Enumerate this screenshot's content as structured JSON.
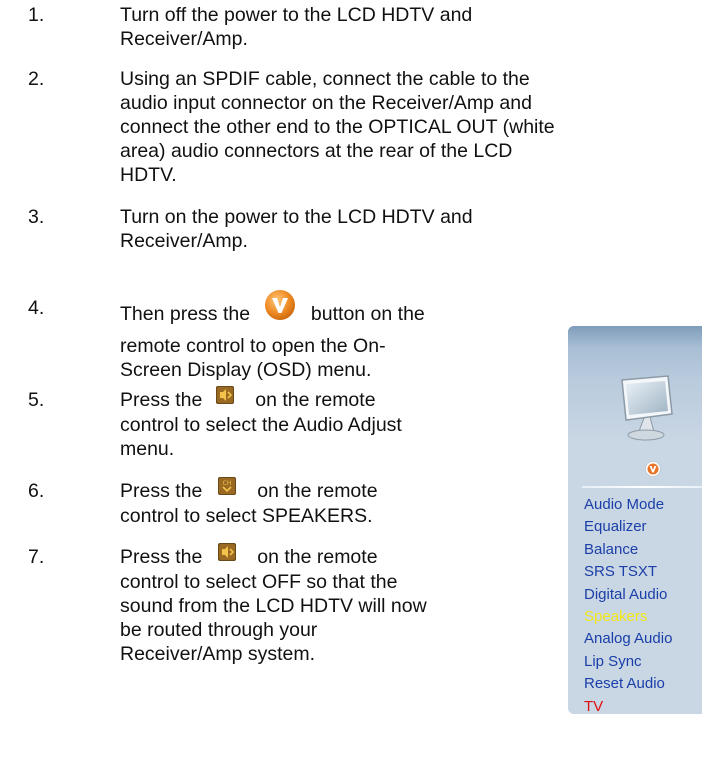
{
  "steps": [
    {
      "num": "1.",
      "lines": [
        "Turn off the power to the LCD HDTV and",
        "Receiver/Amp."
      ]
    },
    {
      "num": "2.",
      "lines": [
        "Using an SPDIF cable, connect the cable to the",
        "audio input connector on the Receiver/Amp and",
        "connect the other end to the OPTICAL OUT (white",
        "area) audio connectors at the rear of the LCD",
        "HDTV."
      ]
    },
    {
      "num": "3.",
      "lines": [
        "Turn on the power to the LCD HDTV and",
        "Receiver/Amp."
      ]
    },
    {
      "num": "4.",
      "pre": "Then press the",
      "post": "button on the",
      "lines": [
        "remote control to open the On-",
        "Screen Display (OSD) menu."
      ],
      "icon": "vizio-v-menu-button-icon"
    },
    {
      "num": "5.",
      "pre": "Press the",
      "post": "on the remote",
      "lines": [
        "control to select the Audio Adjust",
        "menu."
      ],
      "icon": "volume-plus-button-icon"
    },
    {
      "num": "6.",
      "pre": "Press the",
      "post": "on the remote",
      "lines": [
        "control to select SPEAKERS."
      ],
      "icon": "channel-down-button-icon"
    },
    {
      "num": "7.",
      "pre": "Press the",
      "post": "on the remote",
      "lines": [
        "control to select OFF so that the",
        "sound from the LCD HDTV will now",
        "be routed through your",
        "Receiver/Amp system."
      ],
      "icon": "volume-plus-button-icon"
    }
  ],
  "osd_menu": {
    "items": [
      "Audio Mode",
      "Equalizer",
      "Balance",
      "SRS TSXT",
      "Digital Audio",
      "Speakers",
      "Analog Audio",
      "Lip Sync",
      "Reset Audio"
    ],
    "selected": "Speakers",
    "footer": "TV",
    "colors": {
      "item": "#1a3fa8",
      "selected": "#f2e619",
      "footer": "#e01010",
      "panel": "#c9d6e4"
    }
  }
}
